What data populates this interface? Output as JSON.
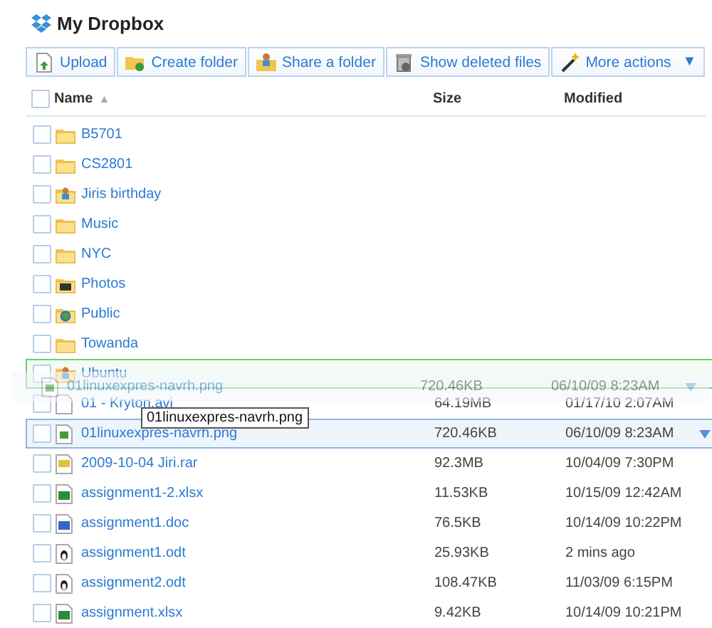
{
  "title": "My Dropbox",
  "toolbar": [
    {
      "label": "Upload",
      "kind": "upload"
    },
    {
      "label": "Create folder",
      "kind": "create-folder"
    },
    {
      "label": "Share a folder",
      "kind": "share-folder"
    },
    {
      "label": "Show deleted files",
      "kind": "deleted"
    },
    {
      "label": "More actions",
      "kind": "more",
      "caret": "▼"
    }
  ],
  "select_all_checked": false,
  "columns": [
    {
      "label": "Name",
      "sorted": true,
      "sort_mark": "▲"
    },
    {
      "label": "Size"
    },
    {
      "label": "Modified"
    }
  ],
  "rows": [
    {
      "name": "B5701",
      "kind": "folder",
      "checked": false,
      "selected": false,
      "drop_target": false
    },
    {
      "name": "CS2801",
      "kind": "folder",
      "checked": false,
      "selected": false,
      "drop_target": false
    },
    {
      "name": "Jiris birthday",
      "kind": "shared-folder",
      "checked": false,
      "selected": false,
      "drop_target": false
    },
    {
      "name": "Music",
      "kind": "folder",
      "checked": false,
      "selected": false,
      "drop_target": false
    },
    {
      "name": "NYC",
      "kind": "folder",
      "checked": false,
      "selected": false,
      "drop_target": false
    },
    {
      "name": "Photos",
      "kind": "photos-folder",
      "checked": false,
      "selected": false,
      "drop_target": false
    },
    {
      "name": "Public",
      "kind": "public-folder",
      "checked": false,
      "selected": false,
      "drop_target": false
    },
    {
      "name": "Towanda",
      "kind": "folder",
      "checked": false,
      "selected": false,
      "drop_target": false
    },
    {
      "name": "Ubuntu",
      "kind": "shared-folder",
      "checked": false,
      "selected": false,
      "drop_target": true
    },
    {
      "name": "01 - Kryton.avi",
      "kind": "file",
      "size": "64.19MB",
      "modified": "01/17/10  2:07AM",
      "checked": false,
      "selected": false,
      "drop_target": false
    },
    {
      "name": "01linuxexpres-navrh.png",
      "kind": "image",
      "size": "720.46KB",
      "modified": "06/10/09  8:23AM",
      "checked": false,
      "selected": true,
      "drop_target": false
    },
    {
      "name": "2009-10-04 Jiri.rar",
      "kind": "archive",
      "size": "92.3MB",
      "modified": "10/04/09  7:30PM",
      "checked": false,
      "selected": false,
      "drop_target": false
    },
    {
      "name": "assignment1-2.xlsx",
      "kind": "spreadsheet",
      "size": "11.53KB",
      "modified": "10/15/09  12:42AM",
      "checked": false,
      "selected": false,
      "drop_target": false
    },
    {
      "name": "assignment1.doc",
      "kind": "document",
      "size": "76.5KB",
      "modified": "10/14/09  10:22PM",
      "checked": false,
      "selected": false,
      "drop_target": false
    },
    {
      "name": "assignment1.odt",
      "kind": "odt",
      "size": "25.93KB",
      "modified": "2 mins ago",
      "checked": false,
      "selected": false,
      "drop_target": false
    },
    {
      "name": "assignment2.odt",
      "kind": "odt",
      "size": "108.47KB",
      "modified": "11/03/09  6:15PM",
      "checked": false,
      "selected": false,
      "drop_target": false
    },
    {
      "name": "assignment.xlsx",
      "kind": "spreadsheet",
      "size": "9.42KB",
      "modified": "10/14/09  10:21PM",
      "checked": false,
      "selected": false,
      "drop_target": false
    }
  ],
  "drag": {
    "name": "01linuxexpres-navrh.png",
    "kind": "image",
    "size": "720.46KB",
    "modified": "06/10/09  8:23AM",
    "tooltip": "01linuxexpres-navrh.png"
  }
}
